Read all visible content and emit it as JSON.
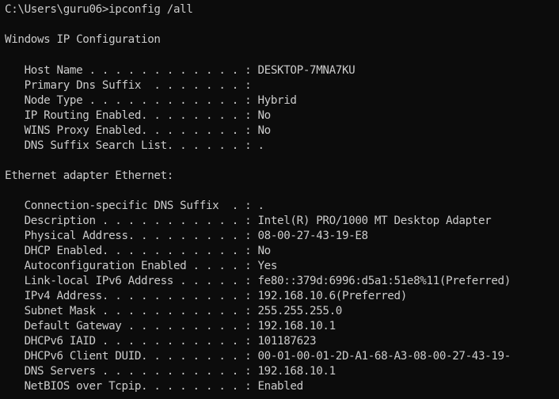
{
  "terminal": {
    "prompt_line": "C:\\Users\\guru06>ipconfig /all",
    "config_header": "Windows IP Configuration",
    "host_name": "   Host Name . . . . . . . . . . . . : DESKTOP-7MNA7KU",
    "primary_dns_suffix": "   Primary Dns Suffix  . . . . . . . :",
    "node_type": "   Node Type . . . . . . . . . . . . : Hybrid",
    "ip_routing": "   IP Routing Enabled. . . . . . . . : No",
    "wins_proxy": "   WINS Proxy Enabled. . . . . . . . : No",
    "dns_suffix_search": "   DNS Suffix Search List. . . . . . : .",
    "adapter_header": "Ethernet adapter Ethernet:",
    "conn_dns_suffix": "   Connection-specific DNS Suffix  . : .",
    "description": "   Description . . . . . . . . . . . : Intel(R) PRO/1000 MT Desktop Adapter",
    "physical_address": "   Physical Address. . . . . . . . . : 08-00-27-43-19-E8",
    "dhcp_enabled": "   DHCP Enabled. . . . . . . . . . . : No",
    "autoconfig_enabled": "   Autoconfiguration Enabled . . . . : Yes",
    "link_local_ipv6": "   Link-local IPv6 Address . . . . . : fe80::379d:6996:d5a1:51e8%11(Preferred)",
    "ipv4_address": "   IPv4 Address. . . . . . . . . . . : 192.168.10.6(Preferred)",
    "subnet_mask": "   Subnet Mask . . . . . . . . . . . : 255.255.255.0",
    "default_gateway": "   Default Gateway . . . . . . . . . : 192.168.10.1",
    "dhcpv6_iaid": "   DHCPv6 IAID . . . . . . . . . . . : 101187623",
    "dhcpv6_duid": "   DHCPv6 Client DUID. . . . . . . . : 00-01-00-01-2D-A1-68-A3-08-00-27-43-19-",
    "dns_servers": "   DNS Servers . . . . . . . . . . . : 192.168.10.1",
    "netbios": "   NetBIOS over Tcpip. . . . . . . . : Enabled"
  }
}
